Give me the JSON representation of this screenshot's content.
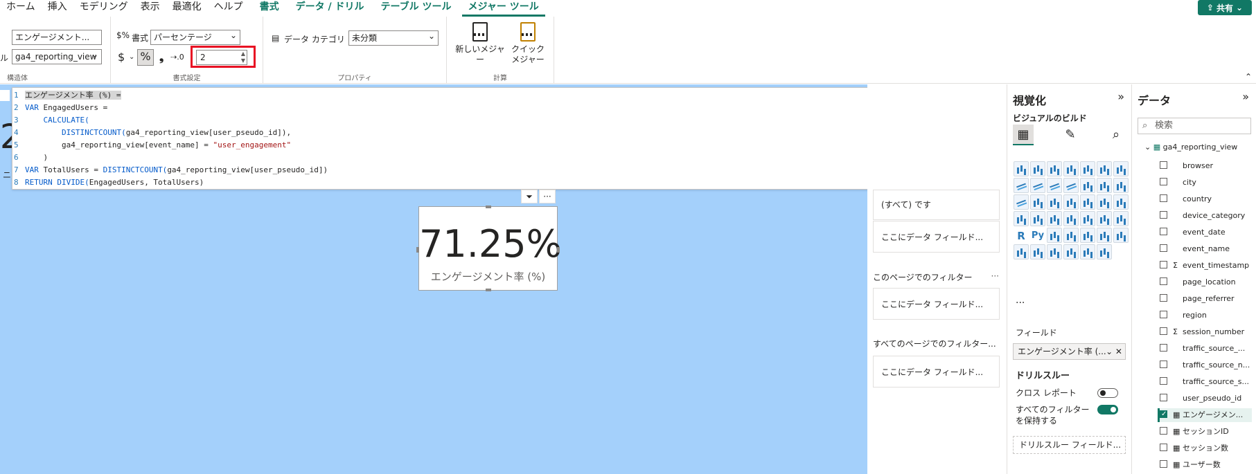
{
  "menu": {
    "items": [
      "ホーム",
      "挿入",
      "モデリング",
      "表示",
      "最適化",
      "ヘルプ"
    ],
    "context_tabs": [
      "書式",
      "データ / ドリル",
      "テーブル ツール",
      "メジャー ツール"
    ],
    "share": "共有"
  },
  "ribbon": {
    "structure": {
      "name_value": "エンゲージメント...",
      "table_prefix": "ル",
      "table_value": "ga4_reporting_view",
      "label": "構造体"
    },
    "formatting": {
      "format_label": "書式",
      "format_value": "パーセンテージ",
      "currency": "$",
      "percent": "%",
      "comma": "❟",
      "decimals_value": "2",
      "label": "書式設定"
    },
    "properties": {
      "category_label": "データ カテゴリ",
      "category_value": "未分類",
      "label": "プロパティ"
    },
    "calculations": {
      "new_measure_label": "新しいメジャー",
      "quick_measure_label_1": "クイック",
      "quick_measure_label_2": "メジャー",
      "label": "計算"
    }
  },
  "editor": {
    "lines": [
      {
        "n": "1",
        "text": "エンゲージメント率 (%) ="
      },
      {
        "n": "2",
        "kw": "VAR",
        "text": " EngagedUsers ="
      },
      {
        "n": "3",
        "indent": "    ",
        "kw": "CALCULATE(",
        "text": ""
      },
      {
        "n": "4",
        "indent": "        ",
        "kw": "DISTINCTCOUNT(",
        "text": "ga4_reporting_view[user_pseudo_id]),"
      },
      {
        "n": "5",
        "indent": "        ",
        "text": "ga4_reporting_view[event_name] = ",
        "str": "\"user_engagement\""
      },
      {
        "n": "6",
        "indent": "    ",
        "text": ")"
      },
      {
        "n": "7",
        "kw": "VAR",
        "text": " TotalUsers = ",
        "kw2": "DISTINCTCOUNT(",
        "text2": "ga4_reporting_view[user_pseudo_id])"
      },
      {
        "n": "8",
        "kw": "RETURN DIVIDE(",
        "text": "EngagedUsers, TotalUsers)"
      }
    ],
    "edge_digit": "2",
    "edge_text": "ニ"
  },
  "card": {
    "value": "71.25%",
    "label": "エンゲージメント率 (%)"
  },
  "filters": {
    "all_value": "(すべて) です",
    "placeholder": "ここにデータ フィールド...",
    "page_filters": "このページでのフィルター",
    "all_pages_filters": "すべてのページでのフィルター...",
    "more": "···"
  },
  "viz": {
    "title": "視覚化",
    "build_label": "ビジュアルのビルド",
    "more": "···",
    "fields_label": "フィールド",
    "field_value": "エンゲージメント率 (...",
    "drillthrough_title": "ドリルスルー",
    "cross_report": "クロス レポート",
    "keep_filters_1": "すべてのフィルター",
    "keep_filters_2": "を保持する",
    "drill_well": "ドリルスルー フィールド...",
    "r_letter": "R",
    "py_letter": "Py"
  },
  "data": {
    "title": "データ",
    "search_placeholder": "検索",
    "table": "ga4_reporting_view",
    "fields": [
      {
        "name": "browser",
        "glyph": ""
      },
      {
        "name": "city",
        "glyph": ""
      },
      {
        "name": "country",
        "glyph": ""
      },
      {
        "name": "device_category",
        "glyph": ""
      },
      {
        "name": "event_date",
        "glyph": ""
      },
      {
        "name": "event_name",
        "glyph": ""
      },
      {
        "name": "event_timestamp",
        "glyph": "Σ"
      },
      {
        "name": "page_location",
        "glyph": ""
      },
      {
        "name": "page_referrer",
        "glyph": ""
      },
      {
        "name": "region",
        "glyph": ""
      },
      {
        "name": "session_number",
        "glyph": "Σ"
      },
      {
        "name": "traffic_source_...",
        "glyph": ""
      },
      {
        "name": "traffic_source_n...",
        "glyph": ""
      },
      {
        "name": "traffic_source_s...",
        "glyph": ""
      },
      {
        "name": "user_pseudo_id",
        "glyph": ""
      },
      {
        "name": "エンゲージメン...",
        "glyph": "▦",
        "checked": true
      },
      {
        "name": "セッションID",
        "glyph": "▦"
      },
      {
        "name": "セッション数",
        "glyph": "▦"
      },
      {
        "name": "ユーザー数",
        "glyph": "▦"
      }
    ]
  },
  "colors": {
    "accent": "#117865",
    "canvas": "#a4d0fb",
    "highlight": "#e81123"
  }
}
